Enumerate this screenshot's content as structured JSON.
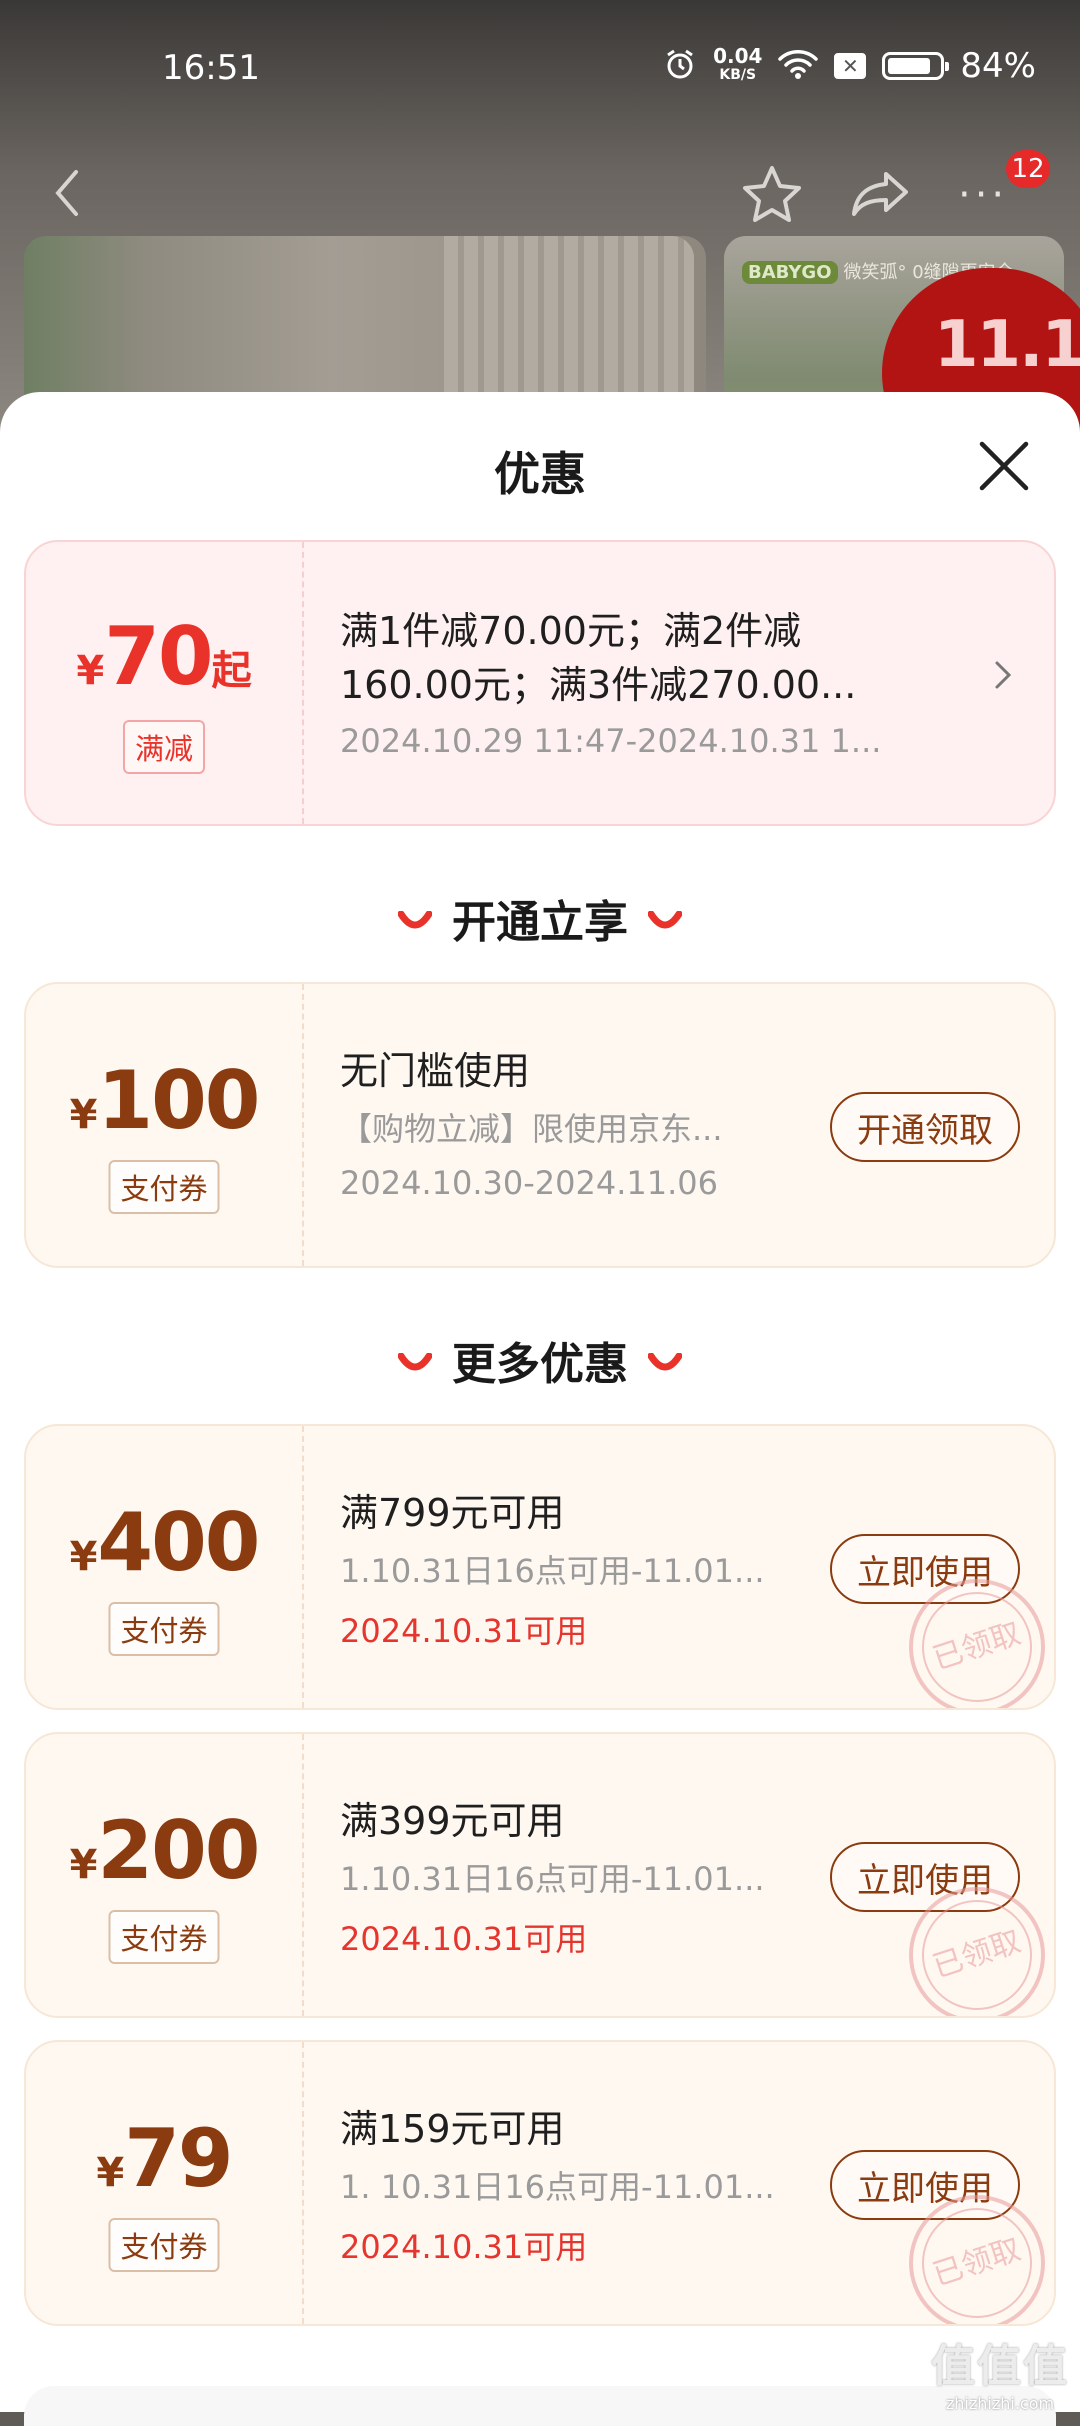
{
  "status_bar": {
    "time": "16:51",
    "net_speed_value": "0.04",
    "net_speed_unit": "KB/S",
    "battery": "84%",
    "icons": [
      "alarm-icon",
      "wifi-icon",
      "sim-off-icon",
      "battery-icon"
    ]
  },
  "nav": {
    "more_badge": "12",
    "icons": [
      "back-icon",
      "star-icon",
      "share-icon",
      "more-icon"
    ]
  },
  "background": {
    "thumb2_brand": "BABYGO",
    "thumb2_caption": "微笑弧° 0缝隙更安全"
  },
  "sheet": {
    "title": "优惠",
    "close_icon": "close-icon"
  },
  "top_offer": {
    "yen": "¥",
    "amount": "70",
    "suffix": "起",
    "tag": "满减",
    "line1": "满1件减70.00元；满2件减",
    "line2": "160.00元；满3件减270.00...",
    "date": "2024.10.29 11:47-2024.10.31 1..."
  },
  "section1": {
    "label": "开通立享"
  },
  "member_offer": {
    "yen": "¥",
    "amount": "100",
    "tag": "支付券",
    "title": "无门槛使用",
    "sub": "【购物立减】限使用京东...",
    "date": "2024.10.30-2024.11.06",
    "button": "开通领取"
  },
  "section2": {
    "label": "更多优惠"
  },
  "coupons": [
    {
      "yen": "¥",
      "amount": "400",
      "tag": "支付券",
      "title": "满799元可用",
      "sub": "1.10.31日16点可用-11.01...",
      "date": "2024.10.31可用",
      "button": "立即使用",
      "stamp": "已领取"
    },
    {
      "yen": "¥",
      "amount": "200",
      "tag": "支付券",
      "title": "满399元可用",
      "sub": "1.10.31日16点可用-11.01...",
      "date": "2024.10.31可用",
      "button": "立即使用",
      "stamp": "已领取"
    },
    {
      "yen": "¥",
      "amount": "79",
      "tag": "支付券",
      "title": "满159元可用",
      "sub": "1. 10.31日16点可用-11.01...",
      "date": "2024.10.31可用",
      "button": "立即使用",
      "stamp": "已领取"
    }
  ],
  "watermark": {
    "logo": "值值值",
    "url": "zhizhizhi.com"
  },
  "colors": {
    "accent_red": "#e8322a",
    "coupon_brown": "#8a3b10",
    "badge_red": "#e62a2a"
  }
}
